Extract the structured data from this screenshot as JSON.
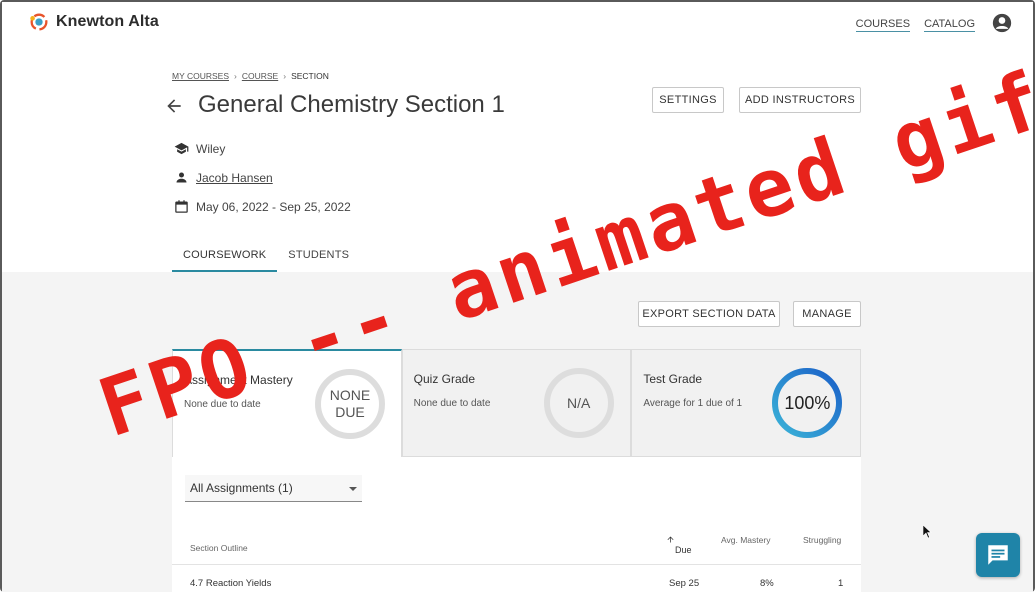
{
  "header": {
    "brand_name": "Knewton Alta",
    "nav": {
      "courses": "COURSES",
      "catalog": "CATALOG"
    }
  },
  "breadcrumb": {
    "my_courses": "MY COURSES",
    "course": "COURSE",
    "section": "SECTION",
    "separator": "›"
  },
  "page": {
    "title": "General Chemistry Section 1"
  },
  "actions": {
    "settings": "SETTINGS",
    "add_instructors": "ADD INSTRUCTORS",
    "export": "EXPORT SECTION DATA",
    "manage": "MANAGE"
  },
  "meta": {
    "publisher": "Wiley",
    "instructor": "Jacob Hansen",
    "dates": "May 06, 2022 - Sep 25, 2022"
  },
  "tabs": {
    "coursework": "COURSEWORK",
    "students": "STUDENTS"
  },
  "cards": [
    {
      "title": "Assignment Mastery",
      "subtitle": "None due to date",
      "ring_line1": "NONE",
      "ring_line2": "DUE",
      "progress": 0
    },
    {
      "title": "Quiz Grade",
      "subtitle": "None due to date",
      "ring": "N/A",
      "progress": 0
    },
    {
      "title": "Test Grade",
      "subtitle": "Average for 1 due of 1",
      "ring": "100%",
      "progress": 1.0
    }
  ],
  "filter": {
    "selected": "All Assignments (1)"
  },
  "table": {
    "headers": {
      "outline": "Section Outline",
      "due": "Due",
      "mastery": "Avg. Mastery",
      "struggling": "Struggling"
    },
    "rows": [
      {
        "name": "4.7 Reaction Yields",
        "due": "Sep 25",
        "mastery": "8%",
        "struggling": "1"
      }
    ]
  },
  "overlay": {
    "text": "FPO -- animated gif"
  },
  "colors": {
    "accent": "#2a8aa0",
    "overlay": "#e8231c",
    "chat": "#1f84a8"
  },
  "icons": [
    "knewton-logo-icon",
    "account-icon",
    "back-arrow-icon",
    "graduation-cap-icon",
    "person-icon",
    "calendar-icon",
    "sort-up-icon",
    "chat-icon"
  ]
}
